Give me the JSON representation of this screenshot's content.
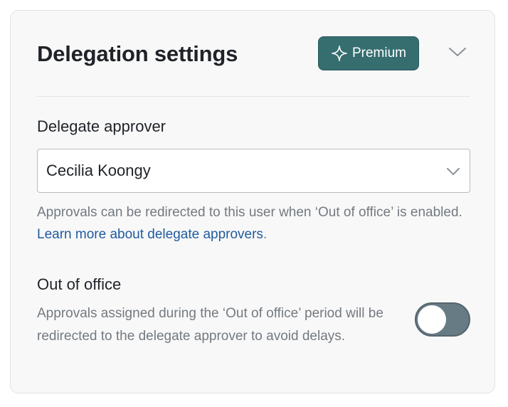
{
  "header": {
    "title": "Delegation settings",
    "premium_label": "Premium",
    "premium_icon": "sparkle-icon",
    "collapse_icon": "chevron-down-icon"
  },
  "delegate": {
    "label": "Delegate approver",
    "selected_value": "Cecilia Koongy",
    "help_text": "Approvals can be redirected to this user when ‘Out of office’ is enabled. ",
    "learn_more_link": "Learn more about delegate approvers",
    "help_suffix": "."
  },
  "out_of_office": {
    "label": "Out of office",
    "help_text": "Approvals assigned during the ‘Out of office’ period will be redirected to the delegate approver to avoid delays.",
    "enabled": false
  },
  "colors": {
    "premium_bg": "#366e70",
    "link": "#1f5b9e",
    "toggle_bg": "#677b85",
    "card_bg": "#f8f8f8"
  }
}
